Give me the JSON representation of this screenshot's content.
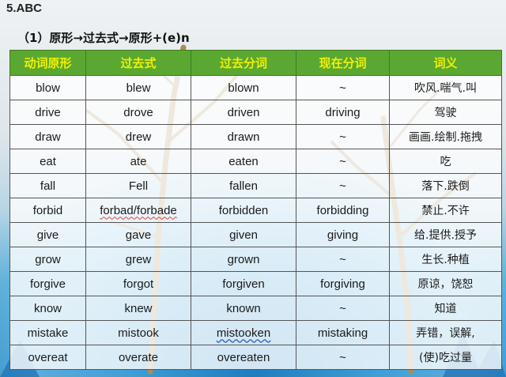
{
  "heading": "5.ABC",
  "subheading": "（1）原形→过去式→原形+(e)n",
  "table": {
    "headers": [
      "动词原形",
      "过去式",
      "过去分词",
      "现在分词",
      "词义"
    ],
    "rows": [
      [
        "blow",
        "blew",
        "blown",
        "~",
        "吹风.喘气.叫"
      ],
      [
        "drive",
        "drove",
        "driven",
        "driving",
        "驾驶"
      ],
      [
        "draw",
        "drew",
        "drawn",
        "~",
        "画画.绘制.拖拽"
      ],
      [
        "eat",
        "ate",
        "eaten",
        "~",
        "吃"
      ],
      [
        "fall",
        "Fell",
        "fallen",
        "~",
        "落下.跌倒"
      ],
      [
        "forbid",
        "forbad/forbade",
        "forbidden",
        "forbidding",
        "禁止.不许"
      ],
      [
        "give",
        "gave",
        "given",
        "giving",
        "给.提供.授予"
      ],
      [
        "grow",
        "grew",
        "grown",
        "~",
        "生长.种植"
      ],
      [
        "forgive",
        "forgot",
        "forgiven",
        "forgiving",
        "原谅，饶恕"
      ],
      [
        "know",
        "knew",
        "known",
        "~",
        "知道"
      ],
      [
        "mistake",
        "mistook",
        "mistooken",
        "mistaking",
        "弄错，误解,"
      ],
      [
        "overeat",
        "overate",
        "overeaten",
        "~",
        "(使)吃过量"
      ]
    ]
  },
  "colors": {
    "header_bg": "#5aa832",
    "header_text": "#f2f000"
  }
}
